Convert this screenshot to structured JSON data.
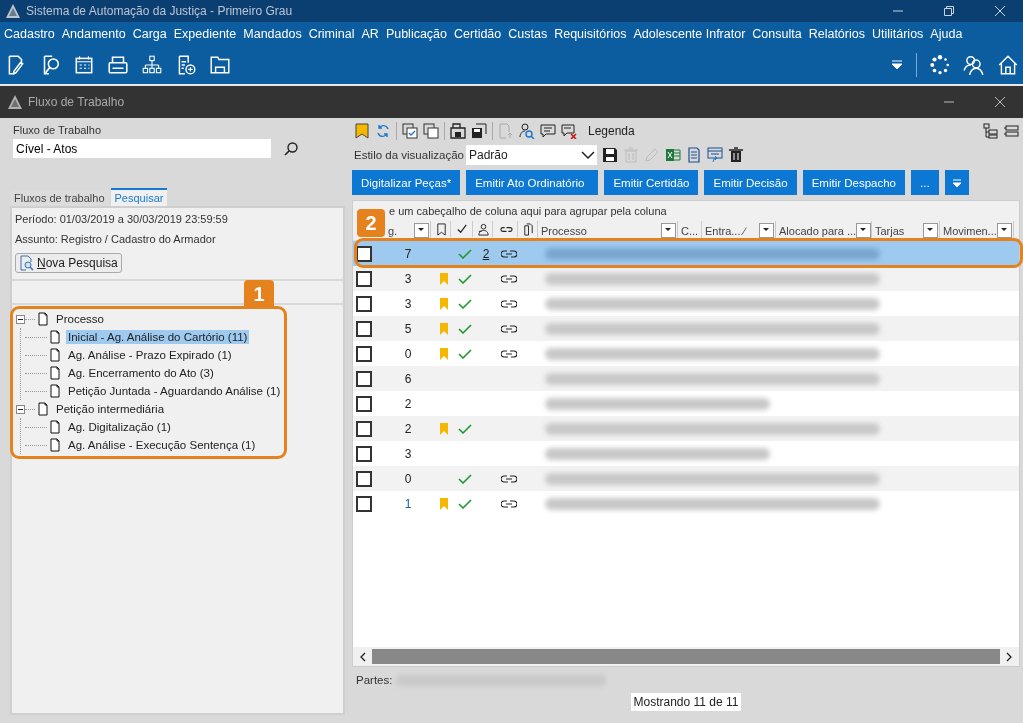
{
  "app": {
    "title": "Sistema de Automação da Justiça - Primeiro Grau"
  },
  "menu": [
    "Cadastro",
    "Andamento",
    "Carga",
    "Expediente",
    "Mandados",
    "Criminal",
    "AR",
    "Publicação",
    "Certidão",
    "Custas",
    "Requisitórios",
    "Adolescente Infrator",
    "Consulta",
    "Relatórios",
    "Utilitários",
    "Ajuda"
  ],
  "window": {
    "title": "Fluxo de Trabalho"
  },
  "left": {
    "field_label": "Fluxo de Trabalho",
    "field_value": "Cível - Atos",
    "tabs": [
      {
        "label": "Fluxos de trabalho",
        "selected": false
      },
      {
        "label": "Pesquisar",
        "selected": true
      }
    ],
    "filters": [
      "Período: 01/03/2019 a 30/03/2019 23:59:59",
      "Assunto: Registro / Cadastro do Armador"
    ],
    "new_search_button": "Nova Pesquisa",
    "tree": [
      {
        "label": "Processo",
        "expanded": true,
        "selected": false,
        "children": [
          {
            "label": "Inicial - Ag. Análise do Cartório (11)",
            "selected": true
          },
          {
            "label": "Ag. Análise - Prazo Expirado (1)",
            "selected": false
          },
          {
            "label": "Ag. Encerramento do Ato (3)",
            "selected": false
          },
          {
            "label": "Petição Juntada - Aguardando Análise (1)",
            "selected": false
          }
        ]
      },
      {
        "label": "Petição intermediária",
        "expanded": true,
        "selected": false,
        "children": [
          {
            "label": "Ag. Digitalização (1)",
            "selected": false
          },
          {
            "label": "Ag. Análise - Execução Sentença (1)",
            "selected": false
          }
        ]
      }
    ]
  },
  "right": {
    "legend_label": "Legenda",
    "view_style_label": "Estilo da visualização",
    "view_style_value": "Padrão",
    "action_buttons": [
      "Digitalizar Peças*",
      "Emitir Ato Ordinatório",
      "Emitir Certidão",
      "Emitir Decisão",
      "Emitir Despacho",
      "..."
    ],
    "group_hint": "e um cabeçalho de coluna aqui para agrupar pela coluna",
    "columns": [
      {
        "label": "g.",
        "filter": true
      },
      {
        "label": "Processo",
        "filter": true
      },
      {
        "label": "C...",
        "filter": false
      },
      {
        "label": "Entra... ∕",
        "filter": true
      },
      {
        "label": "Alocado para ...",
        "filter": true
      },
      {
        "label": "Tarjas",
        "filter": true
      },
      {
        "label": "Movimen...",
        "filter": true
      }
    ],
    "rows": [
      {
        "selected": true,
        "checked": false,
        "count": "7",
        "count_link": false,
        "bookmark": false,
        "done": true,
        "linked_count": "2",
        "chain": true,
        "short_blur": false
      },
      {
        "selected": false,
        "checked": false,
        "count": "3",
        "count_link": false,
        "bookmark": true,
        "done": true,
        "chain": true,
        "short_blur": false
      },
      {
        "selected": false,
        "checked": false,
        "count": "3",
        "count_link": false,
        "bookmark": true,
        "done": true,
        "chain": true,
        "short_blur": false
      },
      {
        "selected": false,
        "checked": false,
        "count": "5",
        "count_link": false,
        "bookmark": true,
        "done": true,
        "chain": true,
        "short_blur": false
      },
      {
        "selected": false,
        "checked": false,
        "count": "0",
        "count_link": false,
        "bookmark": true,
        "done": true,
        "chain": true,
        "short_blur": false
      },
      {
        "selected": false,
        "checked": false,
        "count": "6",
        "count_link": false,
        "bookmark": false,
        "done": false,
        "chain": false,
        "short_blur": false
      },
      {
        "selected": false,
        "checked": false,
        "count": "2",
        "count_link": false,
        "bookmark": false,
        "done": false,
        "chain": false,
        "short_blur": true
      },
      {
        "selected": false,
        "checked": false,
        "count": "2",
        "count_link": false,
        "bookmark": true,
        "done": true,
        "chain": false,
        "short_blur": false
      },
      {
        "selected": false,
        "checked": false,
        "count": "3",
        "count_link": false,
        "bookmark": false,
        "done": false,
        "chain": false,
        "short_blur": true
      },
      {
        "selected": false,
        "checked": false,
        "count": "0",
        "count_link": false,
        "bookmark": false,
        "done": true,
        "chain": true,
        "short_blur": false
      },
      {
        "selected": false,
        "checked": false,
        "count": "1",
        "count_link": true,
        "bookmark": true,
        "done": true,
        "chain": true,
        "short_blur": false
      }
    ],
    "parties_label": "Partes:",
    "status": "Mostrando 11 de 11"
  },
  "callouts": [
    {
      "number": "1"
    },
    {
      "number": "2"
    }
  ]
}
